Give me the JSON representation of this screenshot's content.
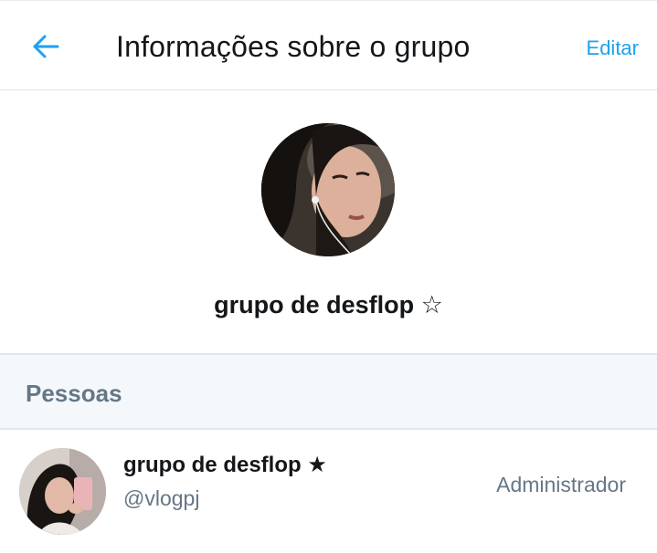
{
  "header": {
    "title": "Informações sobre o grupo",
    "edit_label": "Editar",
    "back_icon": "arrow-left-icon"
  },
  "group": {
    "name": "grupo de desflop ☆",
    "avatar": "group-photo"
  },
  "people_section": {
    "label": "Pessoas"
  },
  "members": [
    {
      "name": "grupo de desflop ★",
      "handle": "@vlogpj",
      "role": "Administrador",
      "avatar": "member-photo"
    }
  ],
  "colors": {
    "accent": "#1da1f2",
    "text_primary": "#14171a",
    "text_secondary": "#657786",
    "section_bg": "#f5f8fa",
    "divider": "#e1e8ed"
  }
}
